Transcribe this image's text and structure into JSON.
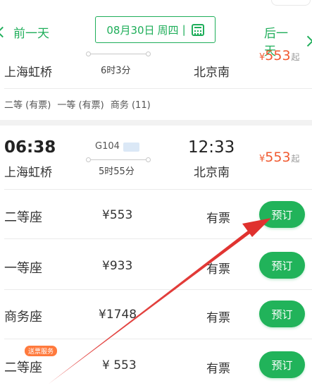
{
  "header": {
    "prev_day": "前一天",
    "next_day": "后一天",
    "date": "08月30日",
    "weekday": "周四",
    "separator": "|"
  },
  "train1": {
    "departure_station": "上海虹桥",
    "duration": "6时3分",
    "arrival_station": "北京南",
    "price_symbol": "¥",
    "price": "553",
    "price_suffix": "起",
    "seat_summary": [
      {
        "label": "二等 (有票)"
      },
      {
        "label": "一等 (有票)"
      },
      {
        "label": "商务 (11)"
      }
    ]
  },
  "train2": {
    "departure_time": "06:38",
    "departure_station": "上海虹桥",
    "train_number": "G104",
    "duration": "5时55分",
    "arrival_time": "12:33",
    "arrival_station": "北京南",
    "price_symbol": "¥",
    "price": "553",
    "price_suffix": "起",
    "seats": [
      {
        "name": "二等座",
        "price": "¥553",
        "status": "有票",
        "button": "预订"
      },
      {
        "name": "一等座",
        "price": "¥933",
        "status": "有票",
        "button": "预订"
      },
      {
        "name": "商务座",
        "price": "¥1748",
        "status": "有票",
        "button": "预订"
      },
      {
        "name": "二等座",
        "price": "¥ 553",
        "status": "有票",
        "button": "预订",
        "tag": "送票服务"
      }
    ]
  },
  "colors": {
    "accent_green": "#1fae5a",
    "button_green": "#21b35a",
    "price_orange": "#f05a31",
    "annotation_red": "#e0312e"
  }
}
